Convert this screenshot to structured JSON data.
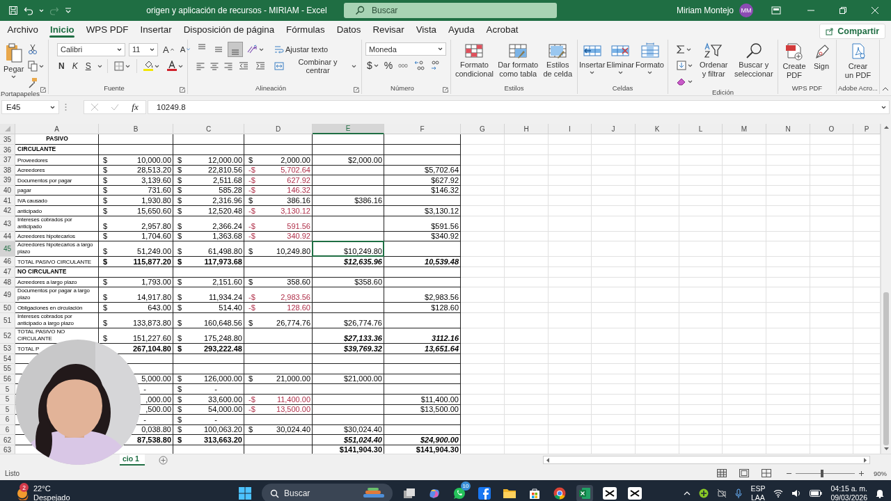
{
  "window": {
    "title": "origen y aplicación de recursos - MIRIAM  -  Excel",
    "search_placeholder": "Buscar",
    "user": "Miriam Montejo",
    "avatar": "MM"
  },
  "menu_tabs": [
    {
      "label": "Archivo",
      "selected": false
    },
    {
      "label": "Inicio",
      "selected": true
    },
    {
      "label": "WPS PDF",
      "selected": false
    },
    {
      "label": "Insertar",
      "selected": false
    },
    {
      "label": "Disposición de página",
      "selected": false
    },
    {
      "label": "Fórmulas",
      "selected": false
    },
    {
      "label": "Datos",
      "selected": false
    },
    {
      "label": "Revisar",
      "selected": false
    },
    {
      "label": "Vista",
      "selected": false
    },
    {
      "label": "Ayuda",
      "selected": false
    },
    {
      "label": "Acrobat",
      "selected": false
    }
  ],
  "share": "Compartir",
  "ribbon": {
    "clipboard": {
      "label": "Portapapeles",
      "paste": "Pegar"
    },
    "font": {
      "label": "Fuente",
      "font_name": "Calibri",
      "font_size": "11",
      "grow": "A",
      "shrink": "A",
      "bold": "N",
      "italic": "K",
      "underline": "S"
    },
    "alignment": {
      "label": "Alineación",
      "wrap": "Ajustar texto",
      "merge": "Combinar y centrar",
      "vertical_align": [
        {
          "selected": false
        },
        {
          "selected": false
        },
        {
          "selected": true
        }
      ]
    },
    "number": {
      "label": "Número",
      "format": "Moneda",
      "currency": "$",
      "percent": "%",
      "thousands": "000"
    },
    "styles": {
      "label": "Estilos",
      "buttons": [
        "Formato condicional",
        "Dar formato como tabla",
        "Estilos de celda"
      ]
    },
    "cells": {
      "label": "Celdas",
      "buttons": [
        "Insertar",
        "Eliminar",
        "Formato"
      ]
    },
    "editing": {
      "label": "Edición",
      "buttons": [
        "Ordenar y filtrar",
        "Buscar y seleccionar"
      ]
    },
    "wps": {
      "label": "WPS PDF",
      "buttons": [
        "Create PDF",
        "Sign"
      ]
    },
    "adobe": {
      "label": "Adobe Acro...",
      "buttons": [
        "Crear un PDF"
      ]
    }
  },
  "formula_bar": {
    "name_box": "E45",
    "function": "fx",
    "formula": "10249.8"
  },
  "columns": [
    {
      "label": "A",
      "selected": false
    },
    {
      "label": "B",
      "selected": false
    },
    {
      "label": "C",
      "selected": false
    },
    {
      "label": "D",
      "selected": false
    },
    {
      "label": "E",
      "selected": true
    },
    {
      "label": "F",
      "selected": false
    },
    {
      "label": "G",
      "selected": false
    },
    {
      "label": "H",
      "selected": false
    },
    {
      "label": "I",
      "selected": false
    },
    {
      "label": "J",
      "selected": false
    },
    {
      "label": "K",
      "selected": false
    },
    {
      "label": "L",
      "selected": false
    },
    {
      "label": "M",
      "selected": false
    },
    {
      "label": "N",
      "selected": false
    },
    {
      "label": "O",
      "selected": false
    },
    {
      "label": "P",
      "selected": false
    }
  ],
  "rows": [
    {
      "n": "35",
      "selected": false,
      "a": {
        "kind": "heading",
        "text": "PASIVO"
      }
    },
    {
      "n": "36",
      "selected": false,
      "a": {
        "kind": "label-bold",
        "text": "CIRCULANTE"
      }
    },
    {
      "n": "37",
      "selected": false,
      "a": {
        "kind": "label",
        "text": "Proveedores"
      },
      "b": {
        "kind": "money",
        "sign": "$",
        "text": "10,000.00"
      },
      "c": {
        "kind": "money",
        "sign": "$",
        "text": "12,000.00"
      },
      "d": {
        "kind": "money",
        "sign": "$",
        "text": "2,000.00"
      },
      "e": {
        "kind": "number",
        "text": "$2,000.00"
      }
    },
    {
      "n": "38",
      "selected": false,
      "a": {
        "kind": "label",
        "text": "Acreedores"
      },
      "b": {
        "kind": "money",
        "sign": "$",
        "text": "28,513.20"
      },
      "c": {
        "kind": "money",
        "sign": "$",
        "text": "22,810.56"
      },
      "d": {
        "kind": "money-negative",
        "sign": "-$",
        "text": "5,702.64"
      },
      "f": {
        "kind": "number",
        "text": "$5,702.64"
      }
    },
    {
      "n": "39",
      "selected": false,
      "a": {
        "kind": "label",
        "text": "Documentos por pagar"
      },
      "b": {
        "kind": "money",
        "sign": "$",
        "text": "3,139.60"
      },
      "c": {
        "kind": "money",
        "sign": "$",
        "text": "2,511.68"
      },
      "d": {
        "kind": "money-negative",
        "sign": "-$",
        "text": "627.92"
      },
      "f": {
        "kind": "number",
        "text": "$627.92"
      }
    },
    {
      "n": "40",
      "selected": false,
      "a": {
        "kind": "label",
        "text": "pagar"
      },
      "b": {
        "kind": "money",
        "sign": "$",
        "text": "731.60"
      },
      "c": {
        "kind": "money",
        "sign": "$",
        "text": "585.28"
      },
      "d": {
        "kind": "money-negative",
        "sign": "-$",
        "text": "146.32"
      },
      "f": {
        "kind": "number",
        "text": "$146.32"
      }
    },
    {
      "n": "41",
      "selected": false,
      "a": {
        "kind": "label",
        "text": "IVA causado"
      },
      "b": {
        "kind": "money",
        "sign": "$",
        "text": "1,930.80"
      },
      "c": {
        "kind": "money",
        "sign": "$",
        "text": "2,316.96"
      },
      "d": {
        "kind": "money",
        "sign": "$",
        "text": "386.16"
      },
      "e": {
        "kind": "number",
        "text": "$386.16"
      }
    },
    {
      "n": "42",
      "selected": false,
      "a": {
        "kind": "label",
        "text": "anticipado"
      },
      "b": {
        "kind": "money",
        "sign": "$",
        "text": "15,650.60"
      },
      "c": {
        "kind": "money",
        "sign": "$",
        "text": "12,520.48"
      },
      "d": {
        "kind": "money-negative",
        "sign": "-$",
        "text": "3,130.12"
      },
      "f": {
        "kind": "number",
        "text": "$3,130.12"
      }
    },
    {
      "n": "43",
      "selected": false,
      "a": {
        "kind": "label",
        "text": "Intereses cobrados por anticipado"
      },
      "b": {
        "kind": "money",
        "sign": "$",
        "text": "2,957.80"
      },
      "c": {
        "kind": "money",
        "sign": "$",
        "text": "2,366.24"
      },
      "d": {
        "kind": "money-negative",
        "sign": "-$",
        "text": "591.56"
      },
      "f": {
        "kind": "number",
        "text": "$591.56"
      }
    },
    {
      "n": "44",
      "selected": false,
      "a": {
        "kind": "label",
        "text": "Acreedores hipotecarios"
      },
      "b": {
        "kind": "money",
        "sign": "$",
        "text": "1,704.60"
      },
      "c": {
        "kind": "money",
        "sign": "$",
        "text": "1,363.68"
      },
      "d": {
        "kind": "money-negative",
        "sign": "-$",
        "text": "340.92"
      },
      "f": {
        "kind": "number",
        "text": "$340.92"
      }
    },
    {
      "n": "45",
      "selected": true,
      "a": {
        "kind": "label",
        "text": "Acreedores hipotecarios a largo plazo"
      },
      "b": {
        "kind": "money",
        "sign": "$",
        "text": "51,249.00"
      },
      "c": {
        "kind": "money",
        "sign": "$",
        "text": "61,498.80"
      },
      "d": {
        "kind": "money",
        "sign": "$",
        "text": "10,249.80"
      },
      "e": {
        "kind": "number",
        "text": "$10,249.80"
      }
    },
    {
      "n": "46",
      "selected": false,
      "a": {
        "kind": "label",
        "text": "TOTAL PASIVO CIRCULANTE"
      },
      "b": {
        "kind": "money-bold",
        "sign": "$",
        "text": "115,877.20"
      },
      "c": {
        "kind": "money-bold",
        "sign": "$",
        "text": "117,973.68"
      },
      "e": {
        "kind": "number-bold-italic",
        "text": "$12,635.96"
      },
      "f": {
        "kind": "number-bold-italic",
        "text": "10,539.48"
      }
    },
    {
      "n": "47",
      "selected": false,
      "a": {
        "kind": "label-bold",
        "text": "NO CIRCULANTE"
      }
    },
    {
      "n": "48",
      "selected": false,
      "a": {
        "kind": "label",
        "text": "Acreedores a largo plazo"
      },
      "b": {
        "kind": "money",
        "sign": "$",
        "text": "1,793.00"
      },
      "c": {
        "kind": "money",
        "sign": "$",
        "text": "2,151.60"
      },
      "d": {
        "kind": "money",
        "sign": "$",
        "text": "358.60"
      },
      "e": {
        "kind": "number",
        "text": "$358.60"
      }
    },
    {
      "n": "49",
      "selected": false,
      "a": {
        "kind": "label",
        "text": "Documentos por pagar a largo plazo"
      },
      "b": {
        "kind": "money",
        "sign": "$",
        "text": "14,917.80"
      },
      "c": {
        "kind": "money",
        "sign": "$",
        "text": "11,934.24"
      },
      "d": {
        "kind": "money-negative",
        "sign": "-$",
        "text": "2,983.56"
      },
      "f": {
        "kind": "number",
        "text": "$2,983.56"
      }
    },
    {
      "n": "50",
      "selected": false,
      "a": {
        "kind": "label",
        "text": "Obligaciones en circulación"
      },
      "b": {
        "kind": "money",
        "sign": "$",
        "text": "643.00"
      },
      "c": {
        "kind": "money",
        "sign": "$",
        "text": "514.40"
      },
      "d": {
        "kind": "money-negative",
        "sign": "-$",
        "text": "128.60"
      },
      "f": {
        "kind": "number",
        "text": "$128.60"
      }
    },
    {
      "n": "51",
      "selected": false,
      "a": {
        "kind": "label",
        "text": "Intereses cobrados por anticipado a largo plazo"
      },
      "b": {
        "kind": "money",
        "sign": "$",
        "text": "133,873.80"
      },
      "c": {
        "kind": "money",
        "sign": "$",
        "text": "160,648.56"
      },
      "d": {
        "kind": "money",
        "sign": "$",
        "text": "26,774.76"
      },
      "e": {
        "kind": "number",
        "text": "$26,774.76"
      }
    },
    {
      "n": "52",
      "selected": false,
      "a": {
        "kind": "label",
        "text": "TOTAL PASIVO NO CIRCULANTE"
      },
      "b": {
        "kind": "money",
        "sign": "$",
        "text": "151,227.60"
      },
      "c": {
        "kind": "money",
        "sign": "$",
        "text": "175,248.80"
      },
      "e": {
        "kind": "number-bold-italic",
        "text": "$27,133.36"
      },
      "f": {
        "kind": "number-bold-italic",
        "text": "3112.16"
      }
    },
    {
      "n": "53",
      "selected": false,
      "a": {
        "kind": "label",
        "text": "TOTAL P"
      },
      "b": {
        "kind": "money-bold",
        "text": "267,104.80"
      },
      "c": {
        "kind": "money-bold",
        "sign": "$",
        "text": "293,222.48"
      },
      "e": {
        "kind": "number-bold-italic",
        "text": "$39,769.32"
      },
      "f": {
        "kind": "number-bold-italic",
        "text": "13,651.64"
      }
    },
    {
      "n": "54",
      "selected": false
    },
    {
      "n": "55",
      "selected": false
    },
    {
      "n": "56",
      "selected": false,
      "b": {
        "kind": "money",
        "text": "5,000.00"
      },
      "c": {
        "kind": "money",
        "sign": "$",
        "text": "126,000.00"
      },
      "d": {
        "kind": "money",
        "sign": "$",
        "text": "21,000.00"
      },
      "e": {
        "kind": "number",
        "text": "$21,000.00"
      }
    },
    {
      "n": "5",
      "selected": false,
      "b": {
        "kind": "money-zero",
        "text": "-"
      },
      "c": {
        "kind": "money-zero",
        "sign": "$",
        "text": "-"
      }
    },
    {
      "n": "5",
      "selected": false,
      "b": {
        "kind": "money",
        "text": ",000.00"
      },
      "c": {
        "kind": "money",
        "sign": "$",
        "text": "33,600.00"
      },
      "d": {
        "kind": "money-negative",
        "sign": "-$",
        "text": "11,400.00"
      },
      "f": {
        "kind": "number",
        "text": "$11,400.00"
      }
    },
    {
      "n": "5",
      "selected": false,
      "b": {
        "kind": "money",
        "text": ",500.00"
      },
      "c": {
        "kind": "money",
        "sign": "$",
        "text": "54,000.00"
      },
      "d": {
        "kind": "money-negative",
        "sign": "-$",
        "text": "13,500.00"
      },
      "f": {
        "kind": "number",
        "text": "$13,500.00"
      }
    },
    {
      "n": "6",
      "selected": false,
      "b": {
        "kind": "money-zero",
        "text": "-"
      },
      "c": {
        "kind": "money-zero",
        "sign": "$",
        "text": "-"
      }
    },
    {
      "n": "6",
      "selected": false,
      "b": {
        "kind": "money",
        "text": "0,038.80"
      },
      "c": {
        "kind": "money",
        "sign": "$",
        "text": "100,063.20"
      },
      "d": {
        "kind": "money",
        "sign": "$",
        "text": "30,024.40"
      },
      "e": {
        "kind": "number",
        "text": "$30,024.40"
      }
    },
    {
      "n": "62",
      "selected": false,
      "b": {
        "kind": "money-bold",
        "text": "87,538.80"
      },
      "c": {
        "kind": "money-bold",
        "sign": "$",
        "text": "313,663.20"
      },
      "e": {
        "kind": "number-bold-italic",
        "text": "$51,024.40"
      },
      "f": {
        "kind": "number-bold-italic",
        "text": "$24,900.00"
      }
    },
    {
      "n": "63",
      "selected": false,
      "e": {
        "kind": "number-bold",
        "text": "$141,904.30"
      },
      "f": {
        "kind": "number-bold",
        "text": "$141,904.30"
      }
    }
  ],
  "sheet_tabs": [
    {
      "label": "cio 1",
      "selected": true
    }
  ],
  "status_bar": {
    "status": "Listo",
    "zoom": {
      "level": 0.45,
      "reading": "90%"
    }
  },
  "taskbar": {
    "weather": {
      "badge": "2",
      "temperature": "22°C",
      "condition": "Despejado"
    },
    "search_placeholder": "Buscar",
    "whatsapp_badge": "10",
    "language": "ESP",
    "layout": "LAA",
    "time": "04:15 a. m.",
    "date": "09/03/2026"
  }
}
